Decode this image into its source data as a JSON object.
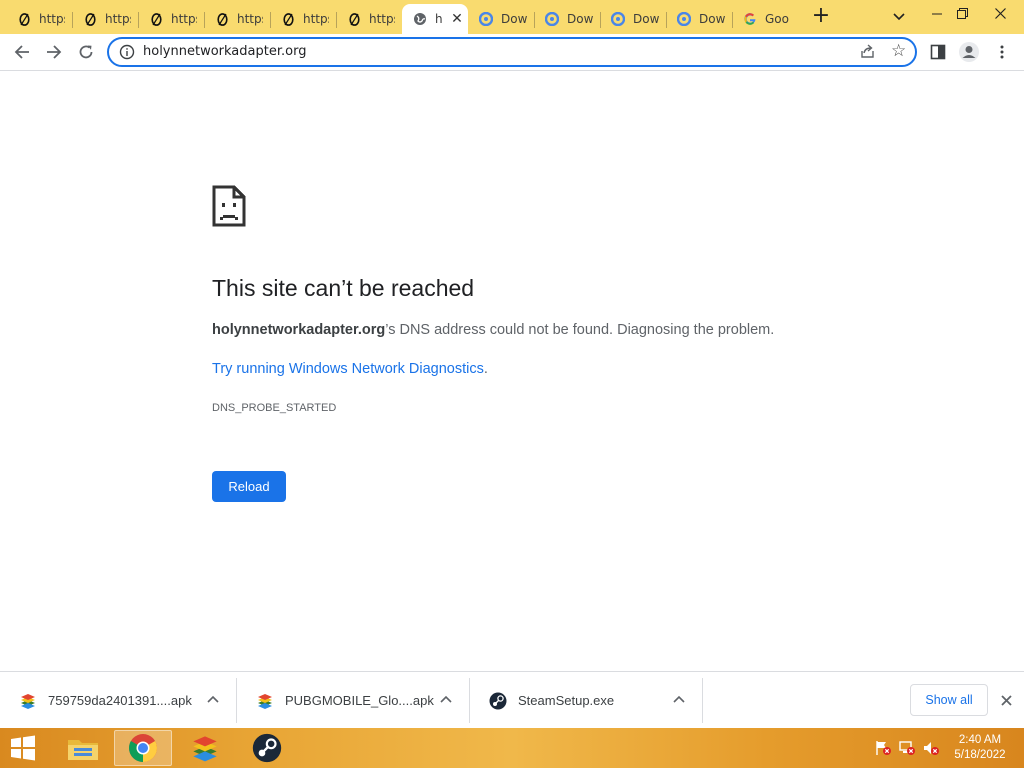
{
  "browser": {
    "tabs": [
      {
        "label": "https",
        "icon": "opera-icon"
      },
      {
        "label": "https",
        "icon": "opera-icon"
      },
      {
        "label": "https",
        "icon": "opera-icon"
      },
      {
        "label": "https",
        "icon": "opera-icon"
      },
      {
        "label": "https",
        "icon": "opera-icon"
      },
      {
        "label": "https",
        "icon": "opera-icon"
      },
      {
        "label": "h",
        "icon": "globe-icon",
        "active": true
      },
      {
        "label": "Dow",
        "icon": "chrome-download-icon"
      },
      {
        "label": "Dow",
        "icon": "chrome-download-icon"
      },
      {
        "label": "Dow",
        "icon": "chrome-download-icon"
      },
      {
        "label": "Dow",
        "icon": "chrome-download-icon"
      },
      {
        "label": "Goo",
        "icon": "google-icon"
      }
    ],
    "new_tab": "+",
    "tab_close": "✕",
    "url": "holynnetworkadapter.org",
    "colors": {
      "frame": "#f9db6f",
      "accent": "#1a73e8"
    }
  },
  "error_page": {
    "title": "This site can’t be reached",
    "domain": "holynnetworkadapter.org",
    "description_rest": "’s DNS address could not be found. Diagnosing the problem.",
    "link_text": "Try running Windows Network Diagnostics",
    "link_period": ".",
    "error_code": "DNS_PROBE_STARTED",
    "reload_label": "Reload"
  },
  "downloads": {
    "items": [
      {
        "name": "759759da2401391....apk",
        "icon": "bluestacks-icon"
      },
      {
        "name": "PUBGMOBILE_Glo....apk",
        "icon": "bluestacks-icon"
      },
      {
        "name": "SteamSetup.exe",
        "icon": "steam-icon"
      }
    ],
    "show_all": "Show all"
  },
  "taskbar": {
    "apps": [
      "file-explorer-icon",
      "chrome-icon",
      "bluestacks-icon",
      "steam-icon"
    ],
    "clock_time": "2:40 AM",
    "clock_date": "5/18/2022"
  }
}
